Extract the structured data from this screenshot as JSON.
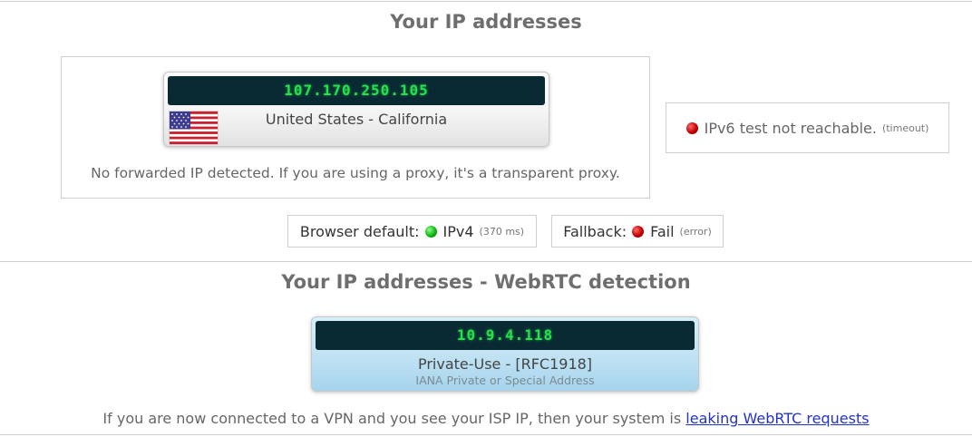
{
  "ip_section": {
    "title": "Your IP addresses",
    "ip": "107.170.250.105",
    "location": "United States - California",
    "flag_icon": "us-flag-icon",
    "proxy_note": "No forwarded IP detected. If you are using a proxy, it's a transparent proxy."
  },
  "ipv6": {
    "status_color": "#c40000",
    "text": "IPv6 test not reachable.",
    "detail": "(timeout)"
  },
  "browser_default": {
    "label": "Browser default:",
    "status_color": "#12b512",
    "value": "IPv4",
    "detail": "(370 ms)"
  },
  "fallback": {
    "label": "Fallback:",
    "status_color": "#c40000",
    "value": "Fail",
    "detail": "(error)"
  },
  "webrtc": {
    "title": "Your IP addresses - WebRTC detection",
    "ip": "10.9.4.118",
    "name": "Private-Use - [RFC1918]",
    "subtitle": "IANA Private or Special Address",
    "note_prefix": "If you are now connected to a VPN and you see your ISP IP, then your system is",
    "note_link": "leaking WebRTC requests"
  },
  "colors": {
    "ip_screen_bg": "#0a2a33",
    "ip_digits": "#27e04a",
    "link": "#2233cc"
  }
}
